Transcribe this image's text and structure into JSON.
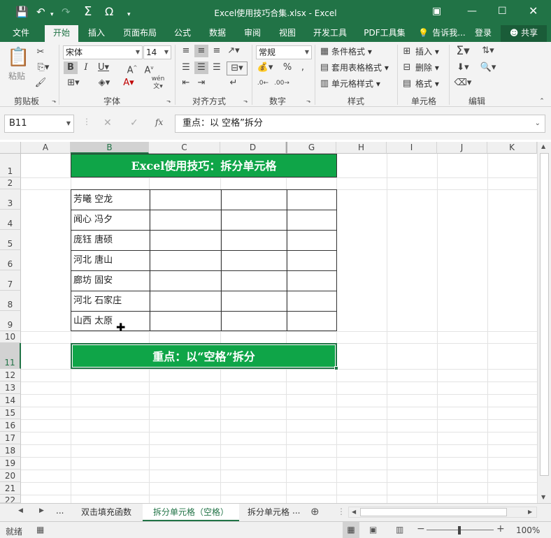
{
  "window": {
    "title": "Excel使用技巧合集.xlsx - Excel"
  },
  "menu": {
    "items": [
      "文件",
      "开始",
      "插入",
      "页面布局",
      "公式",
      "数据",
      "审阅",
      "视图",
      "开发工具",
      "PDF工具集"
    ],
    "active": "开始",
    "tell": "告诉我...",
    "login": "登录",
    "share": "共享"
  },
  "ribbon": {
    "paste": "粘贴",
    "font_name": "宋体",
    "font_size": "14",
    "number_format": "常规",
    "conditional_format": "条件格式",
    "table_format": "套用表格格式",
    "cell_style": "单元格样式",
    "insert": "插入",
    "delete": "删除",
    "format": "格式",
    "groups": [
      "剪贴板",
      "字体",
      "对齐方式",
      "数字",
      "样式",
      "单元格",
      "编辑"
    ]
  },
  "formula_bar": {
    "name_box": "B11",
    "content": "重点：以 空格”拆分"
  },
  "columns": [
    "A",
    "B",
    "C",
    "D",
    "G",
    "H",
    "I",
    "J",
    "K"
  ],
  "rows": [
    "1",
    "2",
    "3",
    "4",
    "5",
    "6",
    "7",
    "8",
    "9",
    "10",
    "11",
    "12",
    "13",
    "14",
    "15",
    "16",
    "17",
    "18",
    "19",
    "20",
    "21",
    "22"
  ],
  "sheet": {
    "title_banner": "Excel使用技巧：拆分单元格",
    "data": [
      "芳曦 空龙",
      "闻心 冯夕",
      "庞钰 唐硕",
      "河北 唐山",
      "廊坊 固安",
      "河北 石家庄",
      "山西 太原"
    ],
    "note_banner": "重点：以“空格”拆分",
    "banner_color": "#0fa548"
  },
  "tabs": {
    "items": [
      "双击填充函数",
      "拆分单元格（空格）",
      "拆分单元格"
    ],
    "active_index": 1,
    "more": "..."
  },
  "status": {
    "text": "就绪",
    "zoom": "100%"
  },
  "theme": {
    "accent": "#217346"
  }
}
